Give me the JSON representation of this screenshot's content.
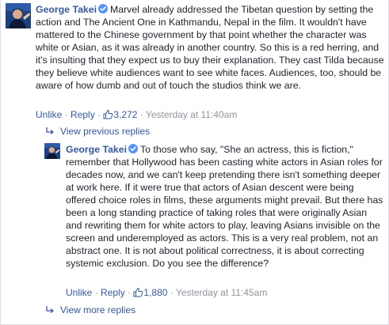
{
  "comment1": {
    "author": "George Takei",
    "text": "Marvel already addressed the Tibetan question by setting the action and The Ancient One in Kathmandu, Nepal in the film. It wouldn't have mattered to the Chinese government by that point whether the character was white or Asian, as it was already in another country. So this is a red herring, and it's insulting that they expect us to buy their explanation. They cast Tilda because they believe white audiences want to see white faces. Audiences, too, should be aware of how dumb and out of touch the studios think we are.",
    "actions": {
      "unlike": "Unlike",
      "reply": "Reply",
      "like_count": "3,272",
      "timestamp": "Yesterday at 11:40am",
      "separator": "·"
    }
  },
  "view_previous_replies": "View previous replies",
  "comment2": {
    "author": "George Takei",
    "text": "To those who say, \"She an actress, this is fiction,\" remember that Hollywood has been casting white actors in Asian roles for decades now, and we can't keep pretending there isn't something deeper at work here. If it were true that actors of Asian descent were being offered choice roles in films, these arguments might prevail. But there has been a long standing practice of taking roles that were originally Asian and rewriting them for white actors to play, leaving Asians invisible on the screen and underemployed as actors. This is a very real problem, not an abstract one. It is not about political correctness, it is about correcting systemic exclusion. Do you see the difference?",
    "actions": {
      "unlike": "Unlike",
      "reply": "Reply",
      "like_count": "1,880",
      "timestamp": "Yesterday at 11:45am",
      "separator": "·"
    }
  },
  "view_more_replies": "View more replies",
  "colors": {
    "link": "#365899",
    "meta": "#90949c",
    "text": "#1d2129",
    "verified": "#5890ff"
  },
  "icons": {
    "verified": "verified-badge-icon",
    "like": "thumbs-up-icon",
    "reply_arrow": "reply-arrow-icon"
  }
}
